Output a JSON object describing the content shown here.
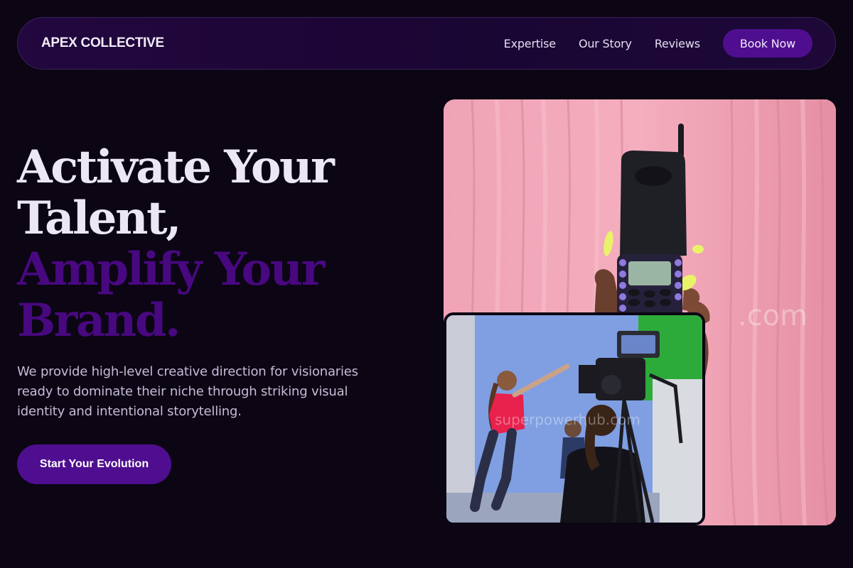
{
  "nav": {
    "brand": "APEX COLLECTIVE",
    "links": [
      "Expertise",
      "Our Story",
      "Reviews"
    ],
    "cta": "Book Now"
  },
  "hero": {
    "headline_line1": "Activate Your",
    "headline_line2": "Talent,",
    "headline_line3": "Amplify Your",
    "headline_line4": "Brand.",
    "subcopy": "We provide high-level creative direction for visionaries ready to dominate their niche through striking visual identity and intentional storytelling.",
    "cta": "Start Your Evolution"
  },
  "images": {
    "main_watermark": ".com",
    "inset_watermark": "superpowerhub.com"
  },
  "colors": {
    "background": "#0b0514",
    "accent": "#4f0e8f",
    "headline_accent": "#48087f"
  }
}
